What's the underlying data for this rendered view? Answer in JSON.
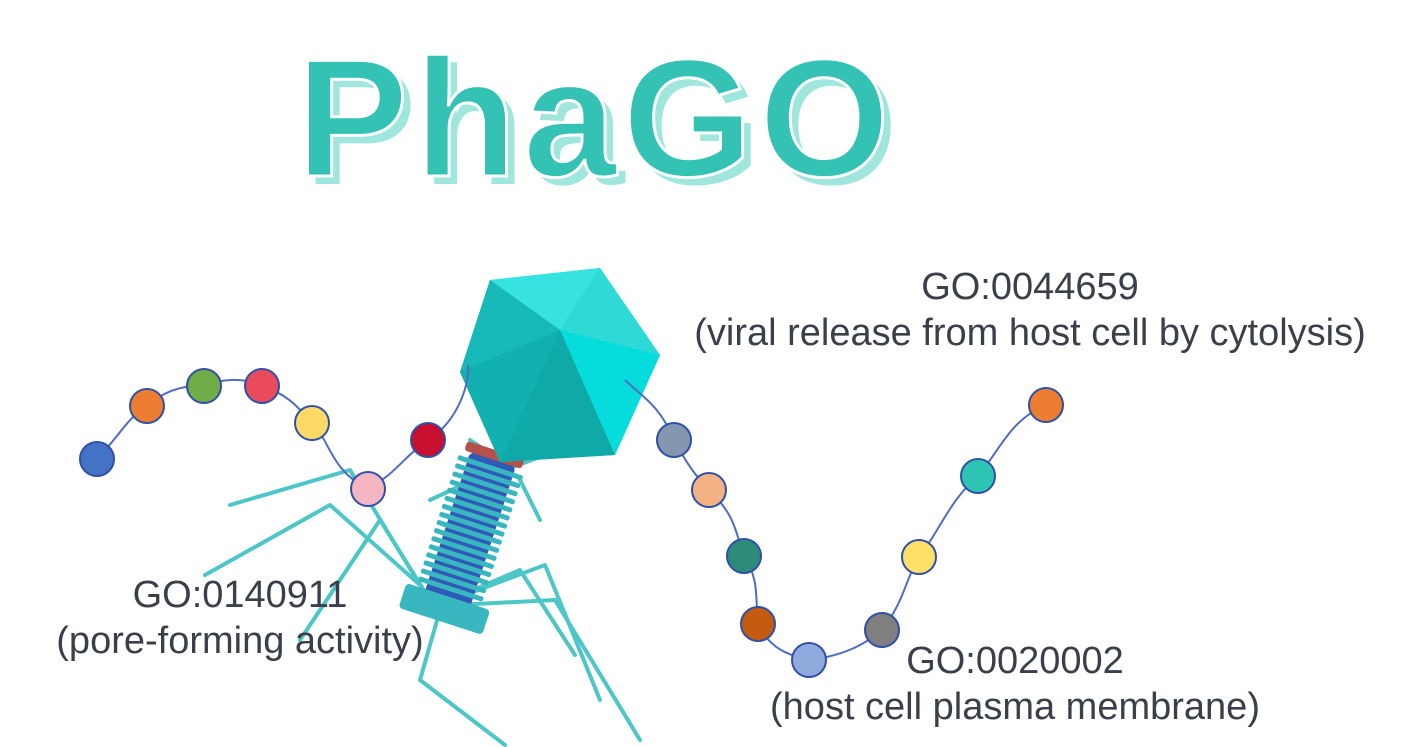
{
  "title": "PhaGO",
  "colors": {
    "title_fill": "#33c2b3",
    "title_shadow": "#9fe6dc",
    "label_text": "#3a3f4a",
    "chain_line": "#4f6cc4",
    "phage_head": "#19c7c6",
    "phage_head_light": "#37e3e0",
    "phage_head_dark": "#0fa9a8",
    "phage_tail": "#39b7c0",
    "phage_tail_inner": "#2f5ab8",
    "phage_collar": "#b5504a",
    "phage_legs": "#4cc6c6"
  },
  "labels": {
    "release": {
      "term": "GO:0044659",
      "desc": "(viral release from host cell by cytolysis)"
    },
    "pore": {
      "term": "GO:0140911",
      "desc": "(pore-forming activity)"
    },
    "membrane": {
      "term": "GO:0020002",
      "desc": "(host cell plasma membrane)"
    }
  },
  "chains": {
    "left": [
      "#4472c4",
      "#ed7d31",
      "#70ad47",
      "#e84c5c",
      "#ffd966",
      "#f4b6c2",
      "#c8102e"
    ],
    "right": [
      "#8497b0",
      "#f4b183",
      "#2e8b7a",
      "#c55a11",
      "#8faadc",
      "#7f7f7f",
      "#ffe066",
      "#2ec4b6",
      "#ed7d31"
    ]
  }
}
